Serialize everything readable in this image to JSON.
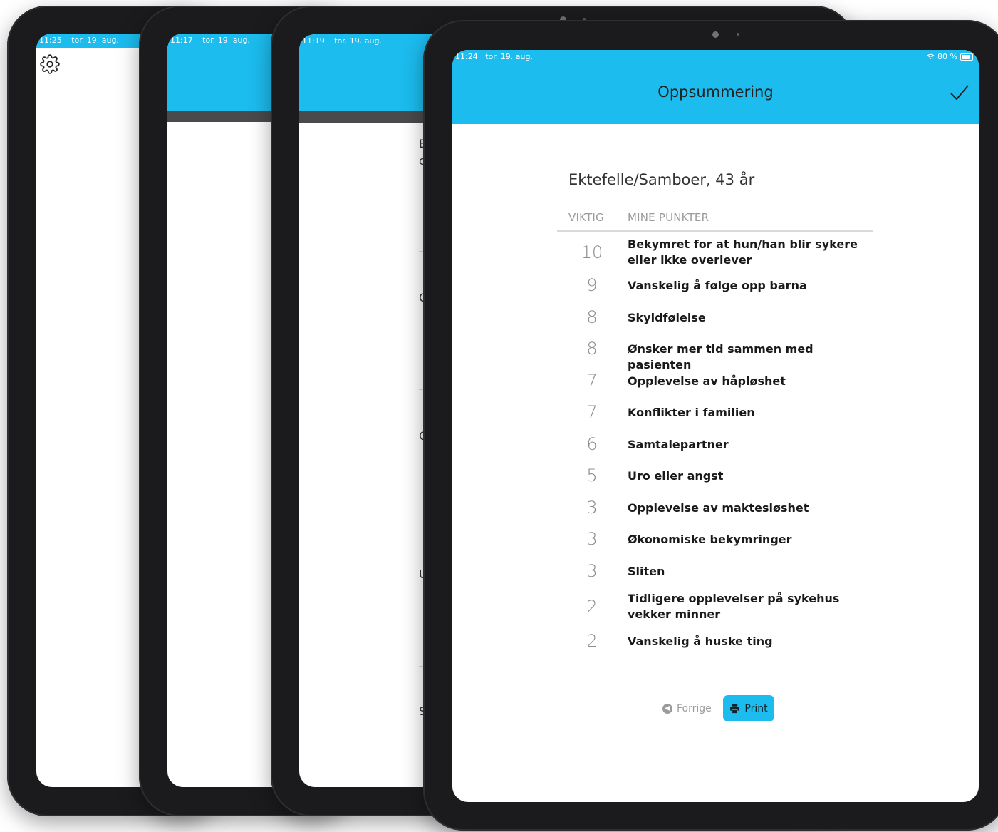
{
  "devices": [
    {
      "time": "11:25",
      "date": "tor. 19. aug."
    },
    {
      "time": "11:17",
      "date": "tor. 19. aug."
    },
    {
      "time": "11:19",
      "date": "tor. 19. aug.",
      "edge_letters": [
        "E",
        "c",
        "C",
        "C",
        "U",
        "S"
      ]
    }
  ],
  "main": {
    "status": {
      "time": "11:24",
      "date": "tor. 19. aug.",
      "battery": "80 %"
    },
    "header_title": "Oppsummering",
    "subject": "Ektefelle/Samboer, 43 år",
    "columns": {
      "importance": "VIKTIG",
      "points": "MINE PUNKTER"
    },
    "items": [
      {
        "score": "10",
        "text": "Bekymret for at hun/han blir sykere eller ikke overlever"
      },
      {
        "score": "9",
        "text": "Vanskelig å følge opp barna"
      },
      {
        "score": "8",
        "text": "Skyldfølelse"
      },
      {
        "score": "8",
        "text": "Ønsker mer tid sammen med pasienten"
      },
      {
        "score": "7",
        "text": "Opplevelse av håpløshet"
      },
      {
        "score": "7",
        "text": "Konflikter i familien"
      },
      {
        "score": "6",
        "text": "Samtalepartner"
      },
      {
        "score": "5",
        "text": "Uro eller angst"
      },
      {
        "score": "3",
        "text": "Opplevelse av maktesløshet"
      },
      {
        "score": "3",
        "text": "Økonomiske bekymringer"
      },
      {
        "score": "3",
        "text": "Sliten"
      },
      {
        "score": "2",
        "text": "Tidligere opplevelser på sykehus vekker minner"
      },
      {
        "score": "2",
        "text": "Vanskelig å huske ting"
      }
    ],
    "buttons": {
      "previous": "Forrige",
      "print": "Print"
    }
  },
  "colors": {
    "accent": "#1cbcee",
    "bezel": "#1b1b1d"
  },
  "icons": [
    "gear-icon",
    "checkmark-icon",
    "wifi-icon",
    "battery-icon",
    "back-arrow-icon",
    "printer-icon"
  ]
}
